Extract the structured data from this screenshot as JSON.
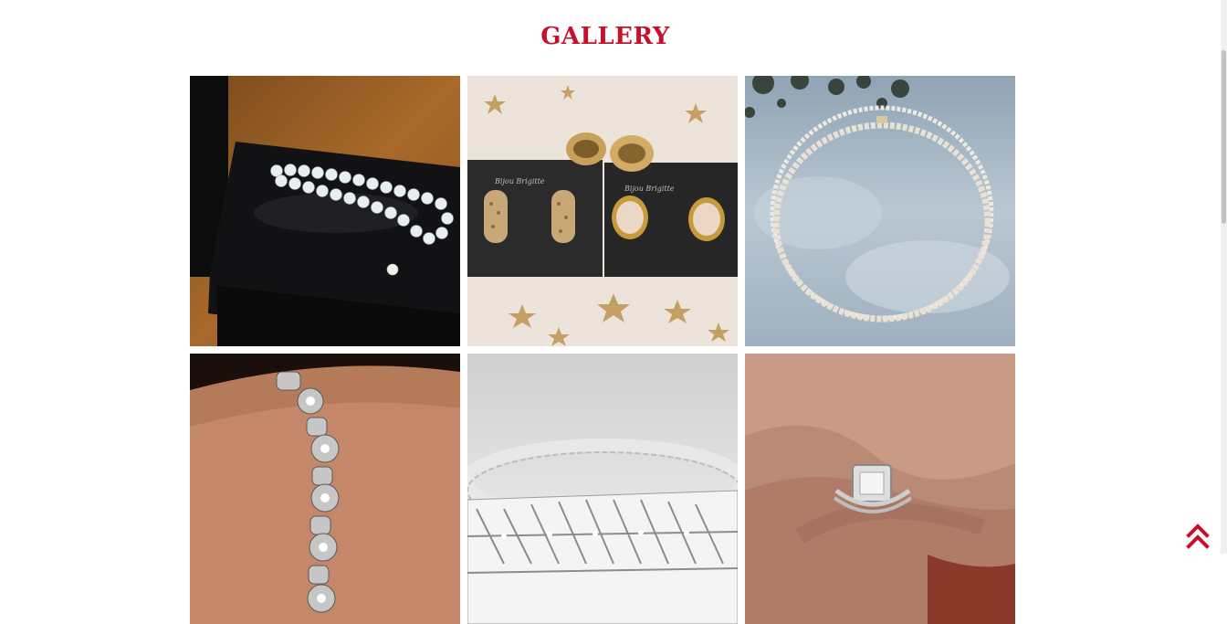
{
  "gallery": {
    "title": "GALLERY",
    "items": [
      {
        "subject": "pearl-bracelet-in-box"
      },
      {
        "subject": "gold-and-pearl-earrings"
      },
      {
        "subject": "pearl-necklace-against-sky"
      },
      {
        "subject": "silver-bracelet-on-wrist"
      },
      {
        "subject": "crystal-bracelet"
      },
      {
        "subject": "diamond-ring-on-hand"
      }
    ]
  },
  "earrings_card_text": [
    "Bijou Brigitte",
    "Bijou Brigitte"
  ],
  "back_to_top": {
    "icon": "double-chevron-up-icon",
    "color": "#c8102e"
  },
  "colors": {
    "accent": "#c8102e",
    "background": "#ffffff"
  }
}
